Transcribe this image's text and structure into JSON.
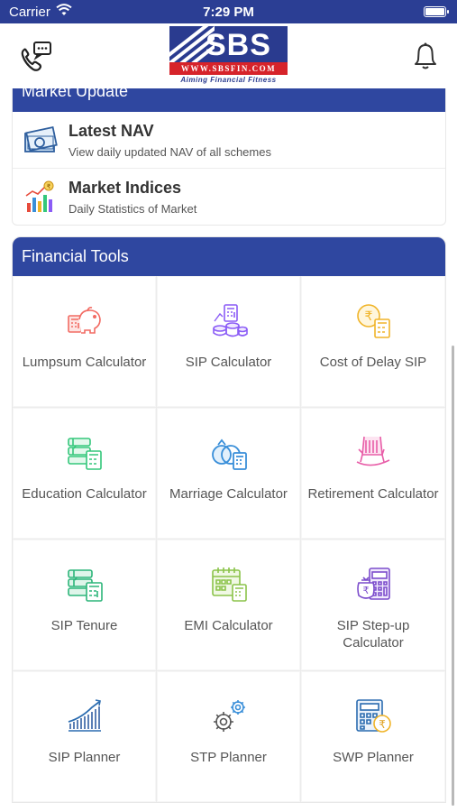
{
  "status_bar": {
    "carrier": "Carrier",
    "time": "7:29 PM"
  },
  "header": {
    "logo_text": "SBS",
    "logo_url": "WWW.SBSFIN.COM",
    "logo_tagline": "Aiming Financial Fitness"
  },
  "market_update": {
    "title": "Market Update",
    "items": [
      {
        "title": "Latest NAV",
        "subtitle": "View daily updated NAV of all schemes",
        "icon": "banknote-icon"
      },
      {
        "title": "Market Indices",
        "subtitle": "Daily Statistics of Market",
        "icon": "chart-icon"
      }
    ]
  },
  "financial_tools": {
    "title": "Financial Tools",
    "items": [
      {
        "label": "Lumpsum Calculator",
        "icon": "piggy-bank-icon",
        "color": "#f26b63"
      },
      {
        "label": "SIP Calculator",
        "icon": "coins-icon",
        "color": "#8b5cf6"
      },
      {
        "label": "Cost of Delay SIP",
        "icon": "rupee-coin-icon",
        "color": "#f0b429"
      },
      {
        "label": "Education Calculator",
        "icon": "books-icon",
        "color": "#34c77b"
      },
      {
        "label": "Marriage Calculator",
        "icon": "rings-icon",
        "color": "#3a8fd9"
      },
      {
        "label": "Retirement Calculator",
        "icon": "rocking-chair-icon",
        "color": "#e85ea8"
      },
      {
        "label": "SIP Tenure",
        "icon": "books-calculator-icon",
        "color": "#2db57a"
      },
      {
        "label": "EMI Calculator",
        "icon": "calendar-icon",
        "color": "#8bc34a"
      },
      {
        "label": "SIP Step-up Calculator",
        "icon": "rupee-calculator-icon",
        "color": "#7c4dcc"
      },
      {
        "label": "SIP Planner",
        "icon": "growth-chart-icon",
        "color": "#2b6cb0"
      },
      {
        "label": "STP Planner",
        "icon": "gears-icon",
        "color": "#555555"
      },
      {
        "label": "SWP Planner",
        "icon": "calculator-rupee-icon",
        "color": "#3a8fd9"
      }
    ]
  },
  "colors": {
    "primary": "#2f47a0",
    "status_bar": "#2b3e94",
    "logo_red": "#d6232a"
  }
}
